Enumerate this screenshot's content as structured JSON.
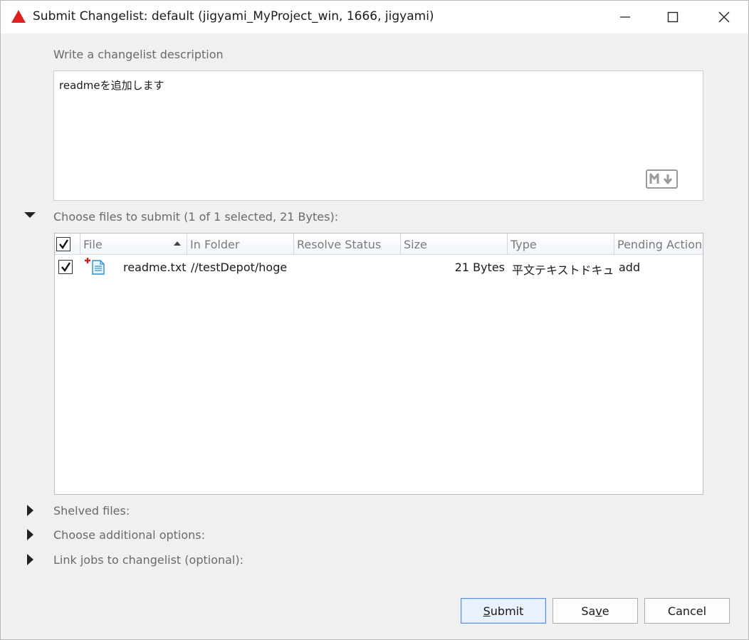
{
  "window": {
    "title": "Submit Changelist: default (jigyami_MyProject_win,  1666,  jigyami)",
    "controls": [
      "minimize-icon",
      "maximize-icon",
      "close-icon"
    ]
  },
  "description": {
    "label": "Write a changelist description",
    "text": "readmeを追加します",
    "markdown_icon": "markdown-icon"
  },
  "files_section": {
    "label": "Choose files to submit (1 of 1 selected, 21 Bytes):",
    "expanded": true,
    "columns": [
      "File",
      "In Folder",
      "Resolve Status",
      "Size",
      "Type",
      "Pending Action"
    ],
    "sorted_by": "File",
    "rows": [
      {
        "checked": true,
        "icon": "added-text-file-icon",
        "file": "readme.txt",
        "folder": "//testDepot/hoge",
        "resolve_status": "",
        "size": "21 Bytes",
        "type": "平文テキストドキュ...",
        "pending_action": "add"
      }
    ]
  },
  "collapsed_sections": [
    {
      "label": "Shelved files:"
    },
    {
      "label": "Choose additional options:"
    },
    {
      "label": "Link jobs to changelist (optional):"
    }
  ],
  "buttons": {
    "submit": {
      "label": "Submit",
      "mnemonic": "S",
      "rest": "ubmit"
    },
    "save": {
      "label": "Save",
      "pre": "Sa",
      "mnemonic": "v",
      "rest": "e"
    },
    "cancel": {
      "label": "Cancel"
    }
  },
  "colors": {
    "accent_border": "#5b8ed8",
    "app_icon": "#e02020",
    "added_mark": "#d42020"
  }
}
